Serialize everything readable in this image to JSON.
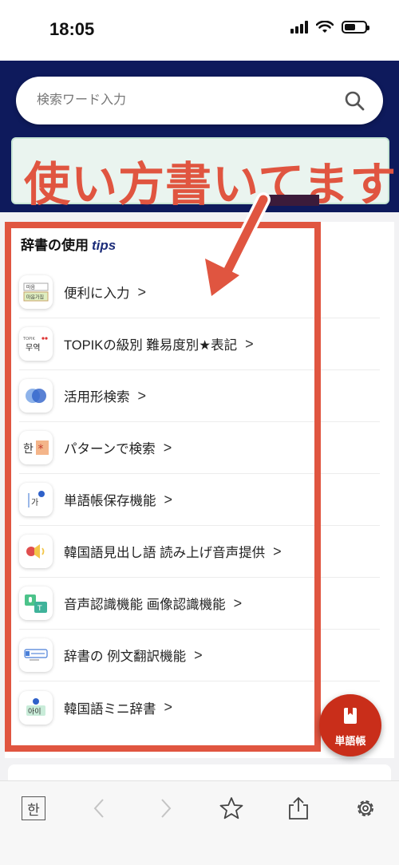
{
  "status_bar": {
    "time": "18:05"
  },
  "search": {
    "placeholder": "検索ワード入力"
  },
  "banner": {
    "text": "使い方書いてます"
  },
  "tips_card": {
    "title": "辞書の使用",
    "title_accent": "tips",
    "items": [
      {
        "label": "便利に入力",
        "icon": "keyboard-input-icon",
        "icon_text": "마음"
      },
      {
        "label": "TOPIKの級別 難易度別★表記",
        "icon": "topik-level-icon",
        "icon_text": "무역"
      },
      {
        "label": "活用形検索",
        "icon": "conjugation-search-icon",
        "icon_text": ""
      },
      {
        "label": "パターンで検索",
        "icon": "pattern-search-icon",
        "icon_text": "한"
      },
      {
        "label": "単語帳保存機能",
        "icon": "wordbook-save-icon",
        "icon_text": "가"
      },
      {
        "label": "韓国語見出し語 読み上げ音声提供",
        "icon": "speaker-icon",
        "icon_text": ""
      },
      {
        "label": "音声認識機能 画像認識機能",
        "icon": "voice-image-recognition-icon",
        "icon_text": ""
      },
      {
        "label": "辞書の 例文翻訳機能",
        "icon": "translate-icon",
        "icon_text": ""
      },
      {
        "label": "韓国語ミニ辞書",
        "icon": "mini-dictionary-icon",
        "icon_text": "아이"
      }
    ],
    "chevron": ">"
  },
  "fab": {
    "label": "単語帳",
    "icon": "bookmark-icon"
  },
  "bottom_nav": {
    "han_label": "한"
  },
  "colors": {
    "header_navy": "#0e1a5c",
    "annotation_red": "#e05540",
    "fab_red": "#c92e1a",
    "tips_accent": "#1c2d7a"
  }
}
